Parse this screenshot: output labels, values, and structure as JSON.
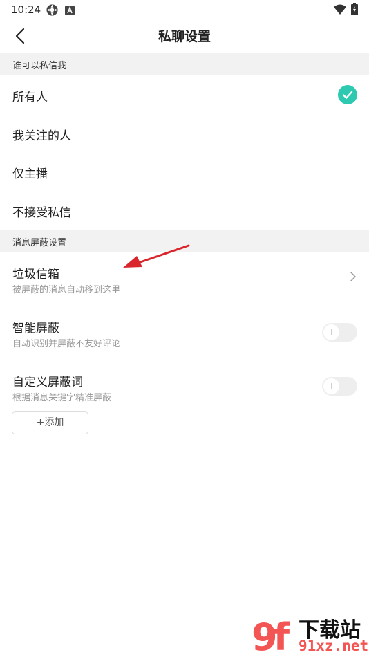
{
  "status_bar": {
    "time": "10:24",
    "icons": [
      "settings-gear-icon",
      "font-a-icon",
      "wifi-icon",
      "battery-icon"
    ]
  },
  "header": {
    "title": "私聊设置",
    "back_icon": "chevron-left-icon"
  },
  "who_can_message": {
    "section_title": "谁可以私信我",
    "options": [
      {
        "label": "所有人",
        "selected": true
      },
      {
        "label": "我关注的人",
        "selected": false
      },
      {
        "label": "仅主播",
        "selected": false
      },
      {
        "label": "不接受私信",
        "selected": false
      }
    ],
    "check_color": "#2dc9b0"
  },
  "block_settings": {
    "section_title": "消息屏蔽设置",
    "trash_box": {
      "title": "垃圾信箱",
      "desc": "被屏蔽的消息自动移到这里",
      "icon": "chevron-right-icon"
    },
    "smart_block": {
      "title": "智能屏蔽",
      "desc": "自动识别并屏蔽不友好评论",
      "enabled": false
    },
    "custom_words": {
      "title": "自定义屏蔽词",
      "desc": "根据消息关键字精准屏蔽",
      "enabled": false,
      "add_label": "+添加"
    }
  },
  "annotation": {
    "arrow_color": "#d9262c",
    "points_to": "trash_box"
  },
  "watermark": {
    "logo_text": "9f",
    "title": "下载站",
    "url": "91xz.net",
    "brand_color": "#f35555"
  }
}
